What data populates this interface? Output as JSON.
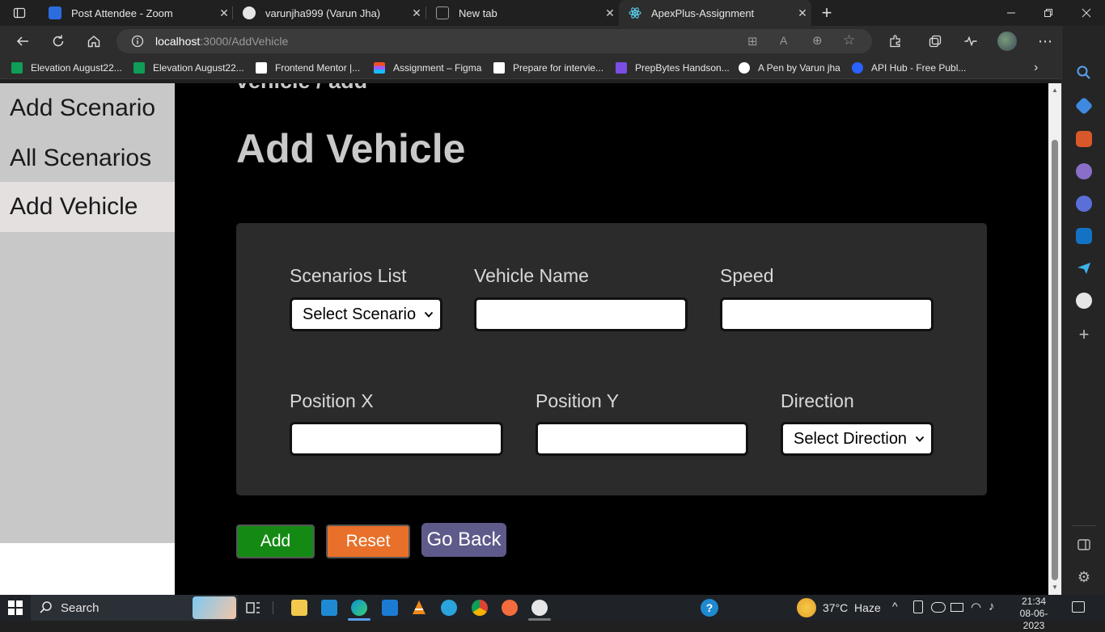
{
  "browser": {
    "tabs": [
      {
        "title": "Post Attendee - Zoom",
        "color": "#2d6cdf"
      },
      {
        "title": "varunjha999 (Varun Jha)",
        "color": "#e6e6e6"
      },
      {
        "title": "New tab",
        "color": "#8a8a8a"
      },
      {
        "title": "ApexPlus-Assignment",
        "color": "#61dafb"
      }
    ],
    "url_host": "localhost",
    "url_path": ":3000/AddVehicle",
    "bookmarks": [
      {
        "label": "Elevation August22...",
        "color": "#0f9d58"
      },
      {
        "label": "Elevation August22...",
        "color": "#0f9d58"
      },
      {
        "label": "Frontend Mentor |...",
        "color": "#ffffff"
      },
      {
        "label": "Assignment – Figma",
        "color": "#a259ff"
      },
      {
        "label": "Prepare for intervie...",
        "color": "#ffffff"
      },
      {
        "label": "PrepBytes Handson...",
        "color": "#7b4ee4"
      },
      {
        "label": "A Pen by Varun jha",
        "color": "#ffffff"
      },
      {
        "label": "API Hub - Free Publ...",
        "color": "#2962ff"
      }
    ]
  },
  "nav": {
    "items": [
      {
        "label": "Add Scenario"
      },
      {
        "label": "All Scenarios"
      },
      {
        "label": "Add Vehicle"
      }
    ]
  },
  "main": {
    "breadcrumb": "vehicle / add",
    "title": "Add Vehicle",
    "form": {
      "scenarios_label": "Scenarios List",
      "scenarios_selected": "Select Scenario",
      "vehicle_name_label": "Vehicle Name",
      "vehicle_name_value": "",
      "speed_label": "Speed",
      "speed_value": "",
      "position_x_label": "Position X",
      "position_x_value": "",
      "position_y_label": "Position Y",
      "position_y_value": "",
      "direction_label": "Direction",
      "direction_selected": "Select Direction"
    },
    "buttons": {
      "add": "Add",
      "reset": "Reset",
      "go_back": "Go Back"
    }
  },
  "taskbar": {
    "search_label": "Search",
    "weather": "37°C  Haze",
    "time": "21:34",
    "date": "08-06-2023"
  },
  "colors": {
    "add_button": "#148a14",
    "reset_button": "#e8702a",
    "go_back_button": "#5e5a8a",
    "form_card": "#2b2b2b",
    "nav_bg": "#c8c8c8"
  }
}
